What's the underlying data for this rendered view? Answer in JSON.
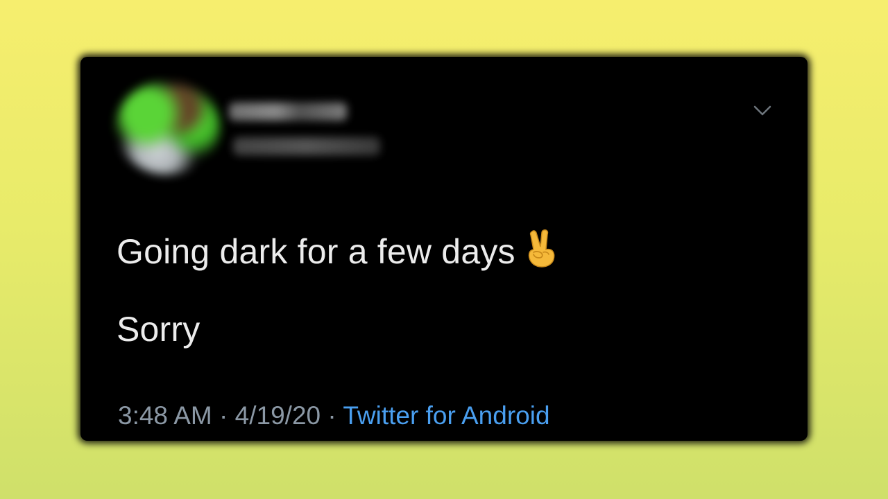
{
  "tweet": {
    "lines": [
      "Going dark for a few days",
      "Sorry"
    ],
    "emoji": "victory-hand-emoji",
    "time": "3:48 AM",
    "separator": "·",
    "date": "4/19/20",
    "source": "Twitter for Android"
  },
  "icons": {
    "menu": "chevron-down-icon",
    "avatar": "blurred-avatar"
  },
  "colors": {
    "background_top": "#f6ee6e",
    "background_bottom": "#cfe06a",
    "card": "#000000",
    "text": "#ececec",
    "meta": "#8b98a5",
    "link": "#4a9ff0"
  }
}
